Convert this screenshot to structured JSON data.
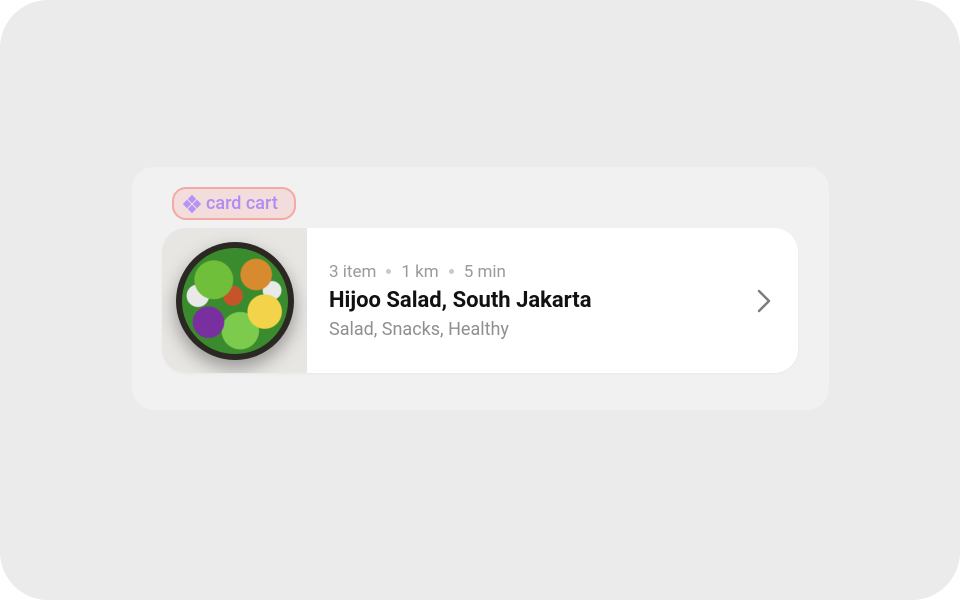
{
  "tag": {
    "label": "card cart"
  },
  "card": {
    "meta": {
      "items": "3 item",
      "distance": "1 km",
      "time": "5 min"
    },
    "title": "Hijoo Salad, South Jakarta",
    "subtitle": "Salad, Snacks, Healthy"
  }
}
